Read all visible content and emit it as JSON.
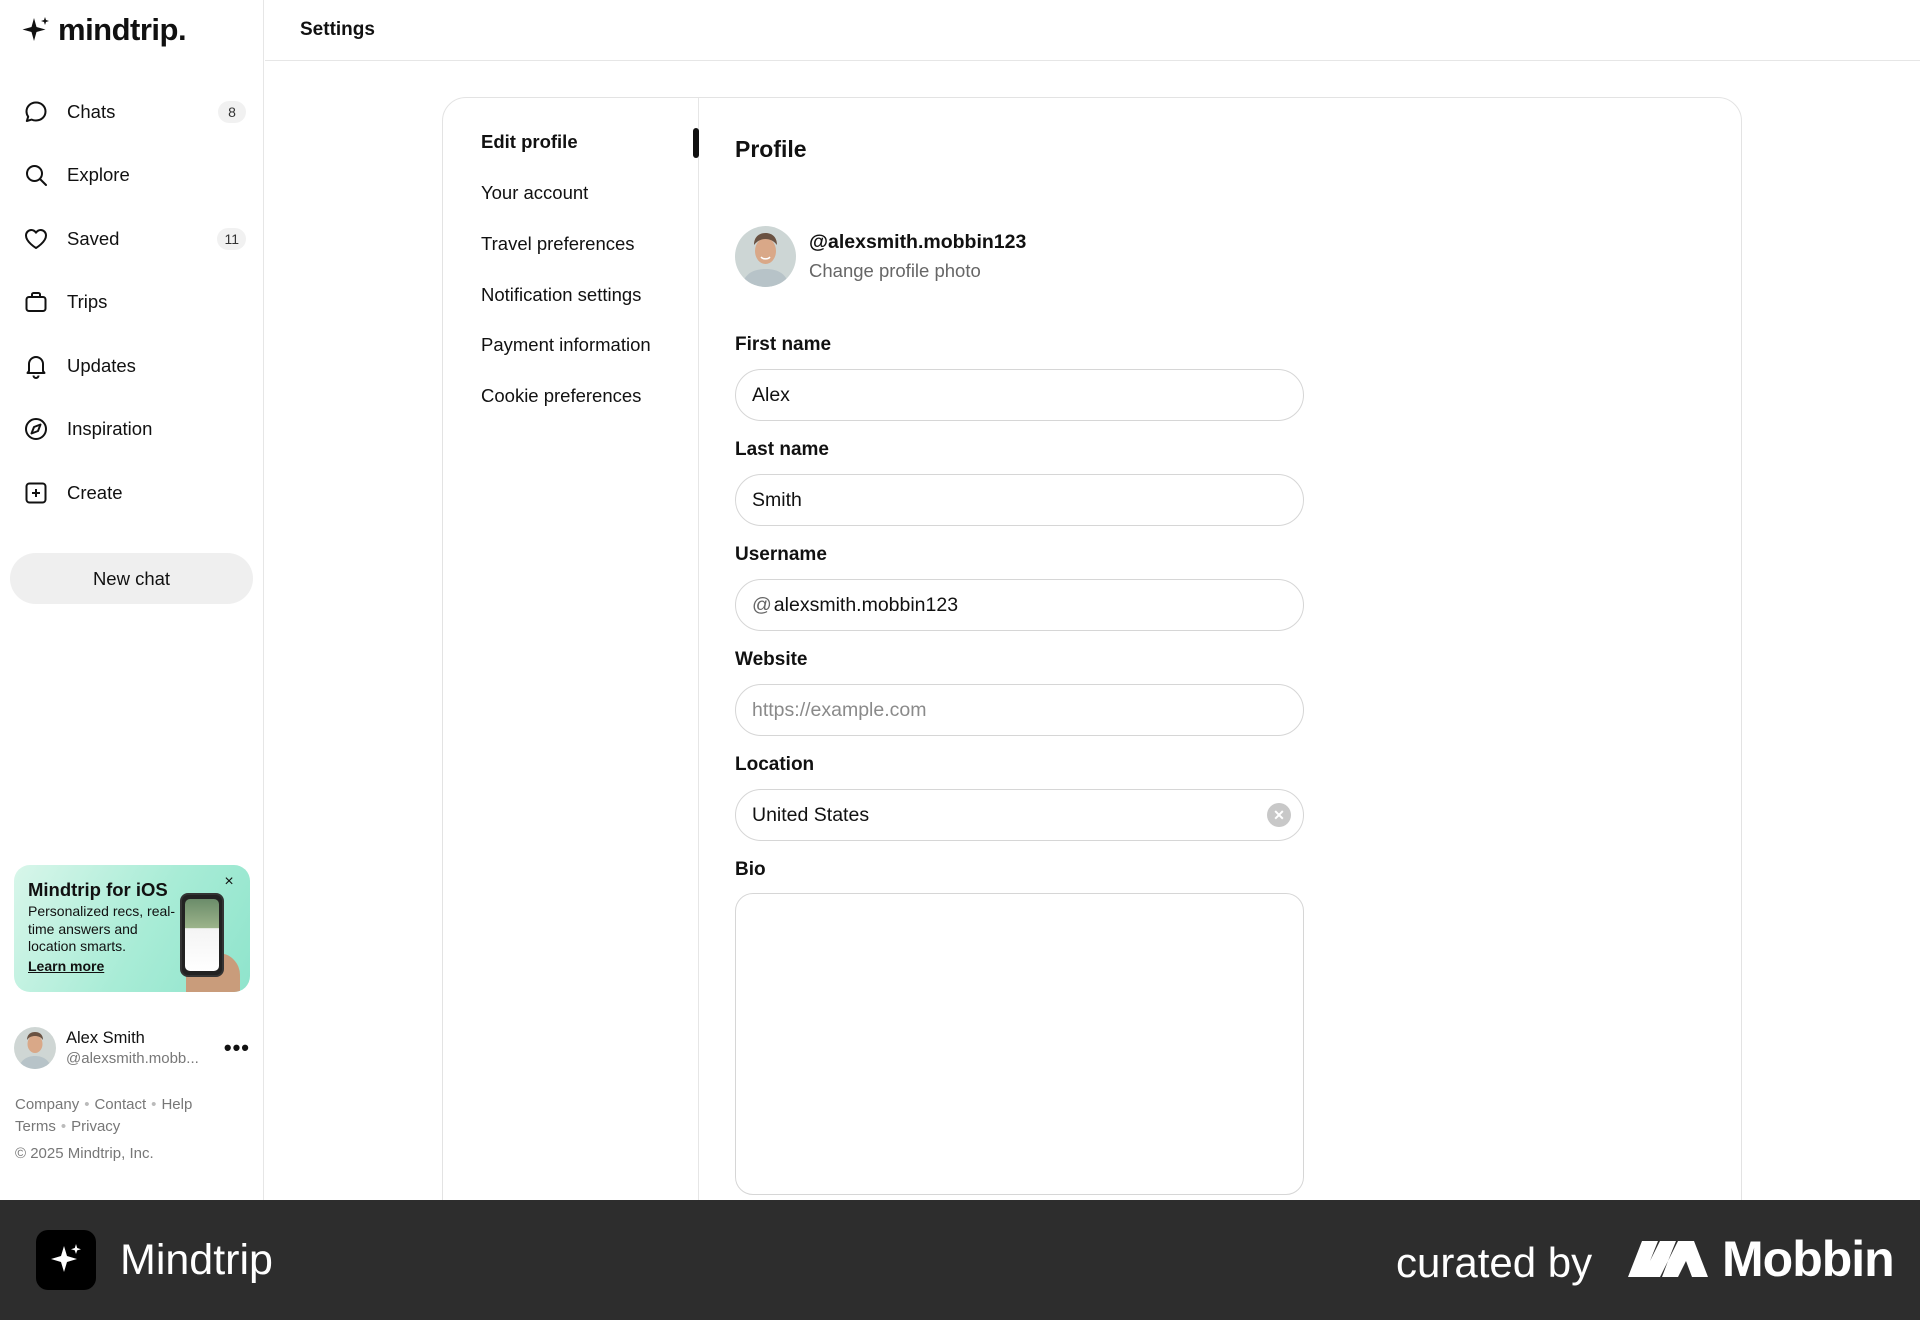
{
  "app": {
    "logo_text": "mindtrip."
  },
  "sidebar": {
    "nav": [
      {
        "label": "Chats",
        "icon": "chat-bubble-icon",
        "badge": "8"
      },
      {
        "label": "Explore",
        "icon": "search-icon",
        "badge": ""
      },
      {
        "label": "Saved",
        "icon": "heart-icon",
        "badge": "11"
      },
      {
        "label": "Trips",
        "icon": "suitcase-icon",
        "badge": ""
      },
      {
        "label": "Updates",
        "icon": "bell-icon",
        "badge": ""
      },
      {
        "label": "Inspiration",
        "icon": "compass-icon",
        "badge": ""
      },
      {
        "label": "Create",
        "icon": "plus-square-icon",
        "badge": ""
      }
    ],
    "new_chat_label": "New chat",
    "promo": {
      "title": "Mindtrip for iOS",
      "text": "Personalized recs, real-time answers and location smarts.",
      "link": "Learn more",
      "close": "×"
    },
    "user": {
      "name": "Alex Smith",
      "handle": "@alexsmith.mobb...",
      "more": "•••"
    },
    "footer": {
      "links_row1": [
        "Company",
        "Contact",
        "Help"
      ],
      "links_row2": [
        "Terms",
        "Privacy"
      ],
      "copyright": "© 2025 Mindtrip, Inc."
    }
  },
  "topbar": {
    "title": "Settings"
  },
  "settings_nav": {
    "items": [
      "Edit profile",
      "Your account",
      "Travel preferences",
      "Notification settings",
      "Payment information",
      "Cookie preferences"
    ],
    "active_index": 0
  },
  "profile": {
    "heading": "Profile",
    "handle": "@alexsmith.mobbin123",
    "change_photo": "Change profile photo",
    "fields": {
      "first_name": {
        "label": "First name",
        "value": "Alex"
      },
      "last_name": {
        "label": "Last name",
        "value": "Smith"
      },
      "username": {
        "label": "Username",
        "prefix": "@",
        "value": "alexsmith.mobbin123"
      },
      "website": {
        "label": "Website",
        "value": "",
        "placeholder": "https://example.com"
      },
      "location": {
        "label": "Location",
        "value": "United States"
      },
      "bio": {
        "label": "Bio",
        "value": ""
      }
    }
  },
  "bottombar": {
    "app_name": "Mindtrip",
    "curated_by": "curated by",
    "brand": "Mobbin"
  },
  "colors": {
    "promo_gradient_start": "#d8f6ea",
    "promo_gradient_end": "#8fe4cc",
    "bottombar_bg": "#2d2d2d",
    "badge_bg": "#f1f1f1"
  }
}
